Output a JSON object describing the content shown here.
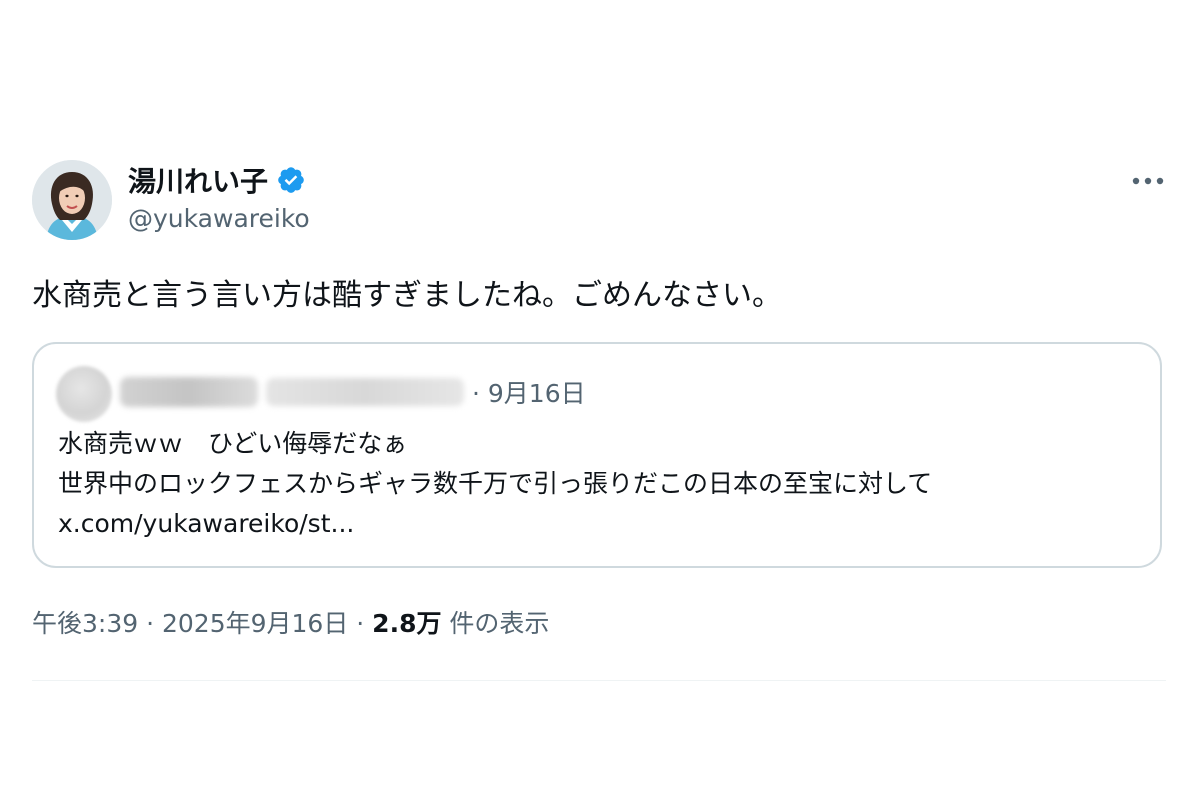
{
  "author": {
    "display_name": "湯川れい子",
    "handle": "@yukawareiko",
    "verified": true
  },
  "icons": {
    "verified": "verified-badge-icon",
    "more": "more-options-icon"
  },
  "tweet": {
    "text": "水商売と言う言い方は酷すぎましたね。ごめんなさい。"
  },
  "quote": {
    "date_prefix": "· ",
    "date": "9月16日",
    "lines": [
      "水商売ｗｗ　ひどい侮辱だなぁ",
      "世界中のロックフェスからギャラ数千万で引っ張りだこの日本の至宝に対して",
      "x.com/yukawareiko/st..."
    ]
  },
  "meta": {
    "time": "午後3:39",
    "separator": " · ",
    "date": "2025年9月16日",
    "views_count": "2.8万",
    "views_label": " 件の表示"
  },
  "colors": {
    "text_primary": "#0f1419",
    "text_secondary": "#536471",
    "verified_blue": "#1d9bf0",
    "border": "#cfd9de"
  }
}
